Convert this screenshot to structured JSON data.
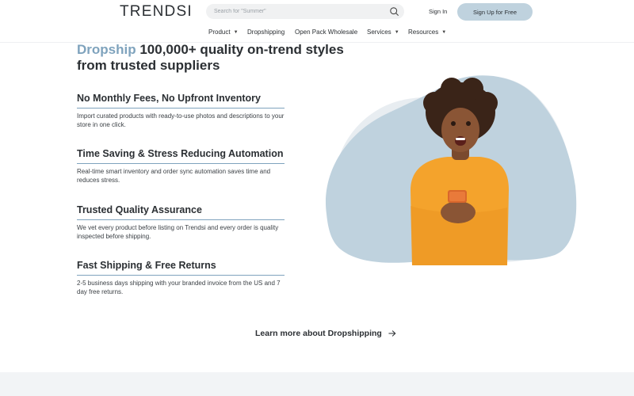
{
  "header": {
    "logo": "TRENDSI",
    "search_placeholder": "Search for \"Summer\"",
    "signin_label": "Sign In",
    "signup_label": "Sign Up for Free"
  },
  "nav": {
    "items": [
      {
        "label": "Product",
        "has_dropdown": true
      },
      {
        "label": "Dropshipping",
        "has_dropdown": false
      },
      {
        "label": "Open Pack Wholesale",
        "has_dropdown": false
      },
      {
        "label": "Services",
        "has_dropdown": true
      },
      {
        "label": "Resources",
        "has_dropdown": true
      }
    ]
  },
  "hero": {
    "headline_accent": "Dropship",
    "headline_rest": " 100,000+ quality on-trend styles from trusted suppliers"
  },
  "features": [
    {
      "title": "No Monthly Fees, No Upfront Inventory",
      "description": "Import curated products with ready-to-use photos and descriptions to your store in one click."
    },
    {
      "title": "Time Saving & Stress Reducing Automation",
      "description": "Real-time smart inventory and order sync automation saves time and reduces stress."
    },
    {
      "title": "Trusted Quality Assurance",
      "description": "We vet every product before listing on Trendsi and every order is quality inspected before shipping."
    },
    {
      "title": "Fast Shipping & Free Returns",
      "description": "2-5 business days shipping with your branded invoice from the US and 7 day free returns."
    }
  ],
  "cta": {
    "learn_more_label": "Learn more about Dropshipping"
  },
  "colors": {
    "accent": "#7fa3bd",
    "signup_bg": "#bfd2de",
    "blob": "#bfd2de",
    "sweater": "#f4a32c"
  },
  "icons": {
    "search": "search-icon",
    "caret": "chevron-down-icon",
    "arrow": "arrow-right-icon"
  }
}
